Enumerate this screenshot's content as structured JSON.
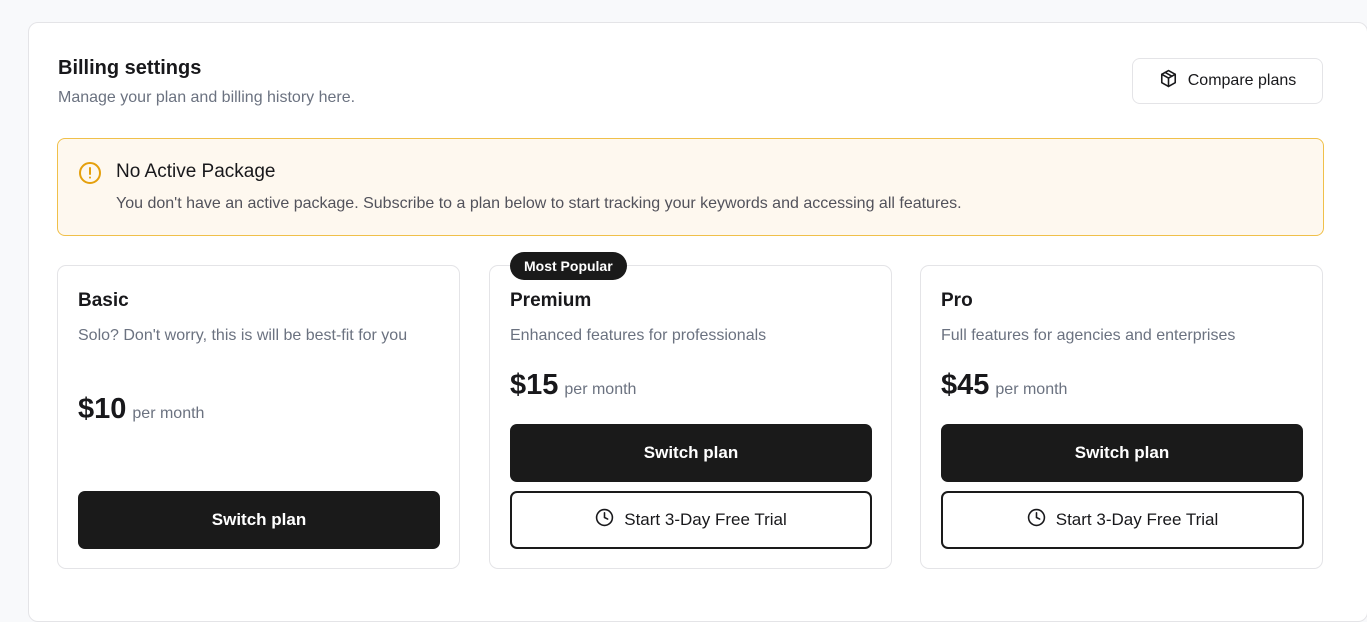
{
  "header": {
    "title": "Billing settings",
    "subtitle": "Manage your plan and billing history here.",
    "compare_label": "Compare plans",
    "compare_icon": "package-icon"
  },
  "alert": {
    "icon": "alert-circle-icon",
    "title": "No Active Package",
    "message": "You don't have an active package. Subscribe to a plan below to start tracking your keywords and accessing all features.",
    "accent_color": "#f0c04a"
  },
  "plans": [
    {
      "name": "Basic",
      "description": "Solo? Don't worry, this is will be best-fit for you",
      "price": "$10",
      "period": "per month",
      "switch_label": "Switch plan"
    },
    {
      "name": "Premium",
      "badge": "Most Popular",
      "description": "Enhanced features for professionals",
      "price": "$15",
      "period": "per month",
      "switch_label": "Switch plan",
      "trial_label": "Start 3-Day Free Trial",
      "trial_icon": "clock-icon"
    },
    {
      "name": "Pro",
      "description": "Full features for agencies and enterprises",
      "price": "$45",
      "period": "per month",
      "switch_label": "Switch plan",
      "trial_label": "Start 3-Day Free Trial",
      "trial_icon": "clock-icon"
    }
  ],
  "colors": {
    "primary_button": "#1a1a1a",
    "alert_background": "#fef8ef",
    "muted_text": "#6b7280"
  }
}
